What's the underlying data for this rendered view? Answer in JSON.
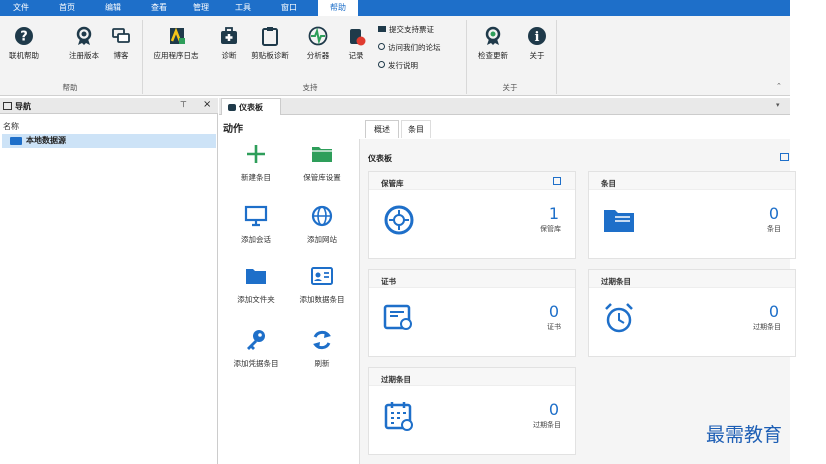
{
  "menu": {
    "items": [
      "文件",
      "首页",
      "编辑",
      "查看",
      "管理",
      "工具",
      "窗口",
      "帮助"
    ],
    "active": "帮助"
  },
  "ribbon": {
    "help_group": {
      "label": "帮助",
      "buttons": [
        "联机帮助",
        "注册版本",
        "博客"
      ]
    },
    "support_group": {
      "label": "支持",
      "buttons": [
        "应用程序日志",
        "诊断",
        "剪贴板诊断",
        "分析器",
        "记录"
      ],
      "small_items": [
        "提交支持票证",
        "访问我们的论坛",
        "发行说明"
      ]
    },
    "about_group": {
      "label": "关于",
      "buttons": [
        "检查更新",
        "关于"
      ]
    }
  },
  "nav": {
    "title": "导航",
    "pin_glyph": "⊤",
    "close_glyph": "×",
    "column_header": "名称",
    "tree_item": "本地数据源"
  },
  "document": {
    "tab_title": "仪表板",
    "collapse_glyph": "▾",
    "actions_title": "动作",
    "actions": [
      "新建条目",
      "保管库设置",
      "添加会话",
      "添加网站",
      "添加文件夹",
      "添加数据条目",
      "添加凭据条目",
      "刷新"
    ],
    "subtabs": [
      "概述",
      "条目"
    ],
    "active_subtab": "概述",
    "dashboard_title": "仪表板",
    "cards": [
      {
        "title": "保管库",
        "value": "1",
        "sub": "保管库"
      },
      {
        "title": "条目",
        "value": "0",
        "sub": "条目"
      },
      {
        "title": "证书",
        "value": "0",
        "sub": "证书"
      },
      {
        "title": "过期条目",
        "value": "0",
        "sub": "过期条目"
      },
      {
        "title": "过期条目",
        "value": "0",
        "sub": "过期条目"
      }
    ]
  },
  "watermark": "最需教育",
  "colors": {
    "accent": "#1e6fc9",
    "icon_dark": "#1f3a4a",
    "green": "#2e9e5a"
  }
}
